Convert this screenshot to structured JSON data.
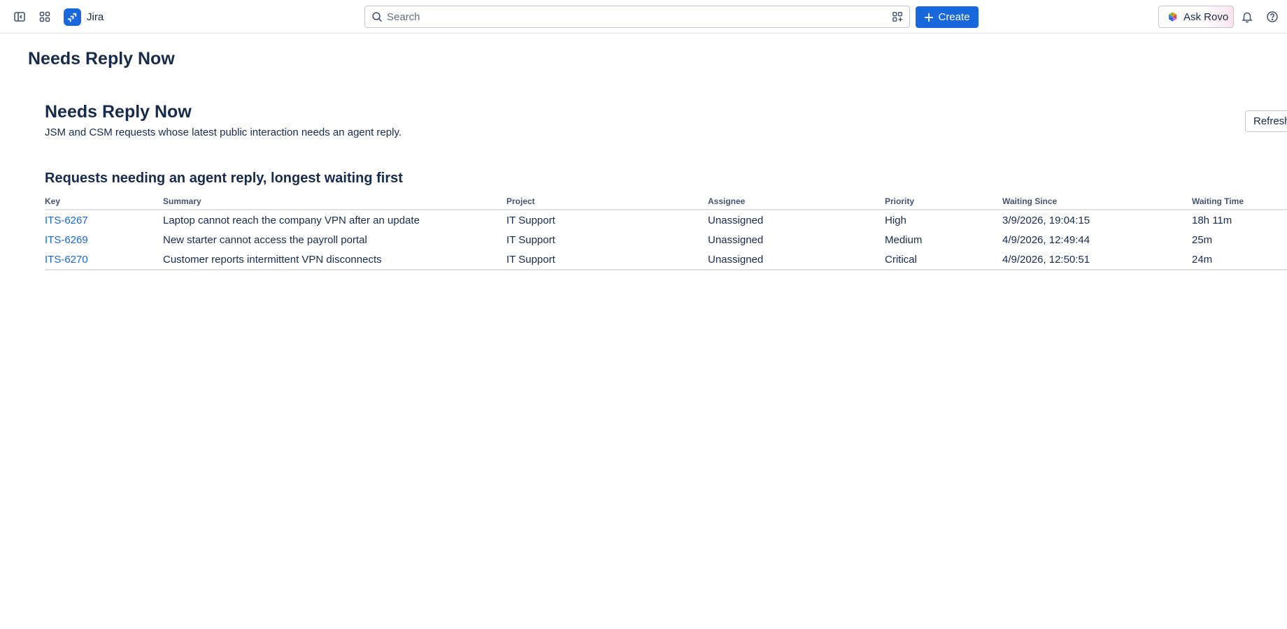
{
  "app": {
    "name": "Jira"
  },
  "search": {
    "placeholder": "Search"
  },
  "header": {
    "create_label": "Create",
    "rovo_label": "Ask Rovo"
  },
  "page": {
    "title": "Needs Reply Now"
  },
  "report": {
    "title": "Needs Reply Now",
    "description": "JSM and CSM requests whose latest public interaction needs an agent reply.",
    "refresh_label": "Refresh",
    "section_title": "Requests needing an agent reply, longest waiting first",
    "columns": [
      "Key",
      "Summary",
      "Project",
      "Assignee",
      "Priority",
      "Waiting Since",
      "Waiting Time"
    ],
    "rows": [
      [
        "ITS-6267",
        "Laptop cannot reach the company VPN after an update",
        "IT Support",
        "Unassigned",
        "High",
        "3/9/2026, 19:04:15",
        "18h 11m"
      ],
      [
        "ITS-6269",
        "New starter cannot access the payroll portal",
        "IT Support",
        "Unassigned",
        "Medium",
        "4/9/2026, 12:49:44",
        "25m"
      ],
      [
        "ITS-6270",
        "Customer reports intermittent VPN disconnects",
        "IT Support",
        "Unassigned",
        "Critical",
        "4/9/2026, 12:50:51",
        "24m"
      ]
    ]
  },
  "icons": {
    "sidebar_toggle": "sidebar-toggle-icon",
    "app_switcher": "app-switcher-icon",
    "search": "search-icon",
    "search_filter": "filter-icon",
    "notifications": "bell-icon",
    "help": "help-icon"
  },
  "colors": {
    "brand": "#1868db",
    "link": "#1868db",
    "text": "#172b4d",
    "border": "#dfe1e6"
  }
}
